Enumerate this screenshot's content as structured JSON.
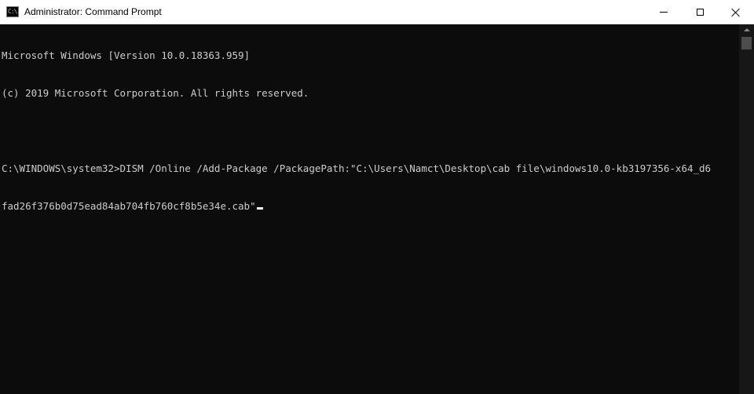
{
  "window": {
    "title": "Administrator: Command Prompt",
    "icon": "command-prompt-icon",
    "icon_glyph": "C:\\.",
    "controls": {
      "minimize": "minimize-icon",
      "maximize": "maximize-icon",
      "close": "close-icon"
    }
  },
  "console": {
    "lines": [
      "Microsoft Windows [Version 10.0.18363.959]",
      "(c) 2019 Microsoft Corporation. All rights reserved.",
      "",
      "C:\\WINDOWS\\system32>DISM /Online /Add-Package /PackagePath:\"C:\\Users\\Namct\\Desktop\\cab file\\windows10.0-kb3197356-x64_d6",
      "fad26f376b0d75ead84ab704fb760cf8b5e34e.cab\""
    ]
  },
  "colors": {
    "console_background": "#0c0c0c",
    "console_text": "#cccccc",
    "titlebar_background": "#ffffff",
    "cursor": "#ffffff"
  }
}
